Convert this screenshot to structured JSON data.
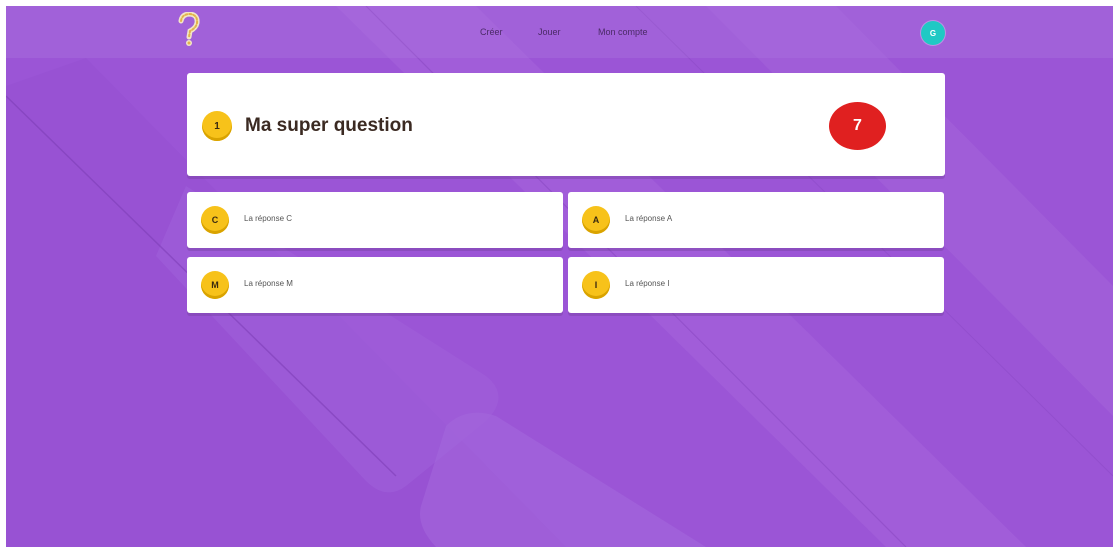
{
  "nav": {
    "items": [
      {
        "label": "Créer"
      },
      {
        "label": "Jouer"
      },
      {
        "label": "Mon compte"
      }
    ]
  },
  "user": {
    "avatar_initial": "G",
    "avatar_color": "#1fc9c4"
  },
  "question": {
    "number": "1",
    "text": "Ma super question"
  },
  "timer": {
    "value": "7",
    "color": "#e02020"
  },
  "answers": [
    {
      "letter": "C",
      "text": "La réponse C"
    },
    {
      "letter": "A",
      "text": "La réponse A"
    },
    {
      "letter": "M",
      "text": "La réponse M"
    },
    {
      "letter": "I",
      "text": "La réponse I"
    }
  ],
  "colors": {
    "background": "#9b55d6",
    "badge": "#f7c21a",
    "card": "#ffffff"
  },
  "icons": {
    "logo": "question-mark-logo-icon"
  }
}
